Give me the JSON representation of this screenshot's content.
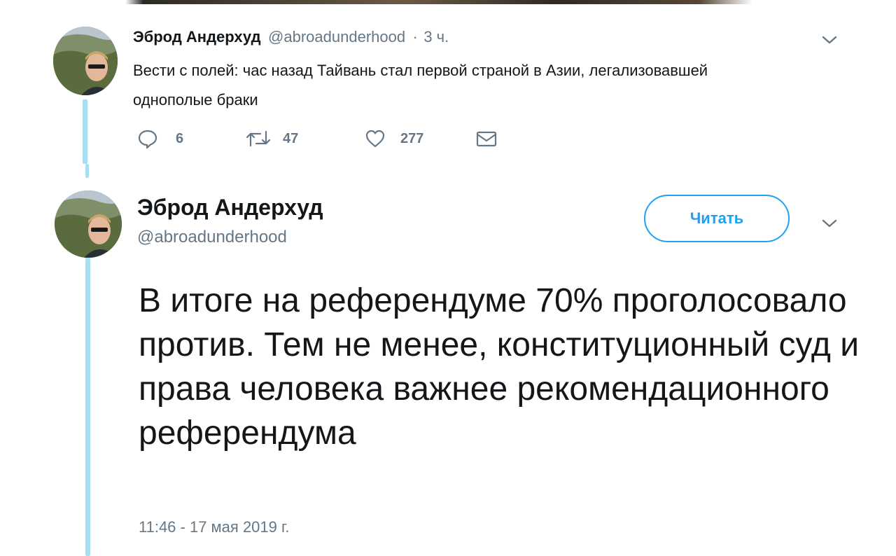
{
  "tweet1": {
    "author_name": "Эброд Андерхуд",
    "handle": "@abroadunderhood",
    "separator": "·",
    "time": "3 ч.",
    "text": "Вести с полей: час назад Тайвань стал первой страной в Азии, легализовавшей однополые браки",
    "actions": {
      "reply_count": "6",
      "retweet_count": "47",
      "like_count": "277"
    }
  },
  "tweet2": {
    "author_name": "Эброд Андерхуд",
    "handle": "@abroadunderhood",
    "follow_label": "Читать",
    "text": "В итоге на референдуме 70% проголосовало против. Тем не менее, конституционный суд и права человека важнее рекомендационного референдума",
    "timestamp": "11:46 - 17 мая 2019 г."
  },
  "colors": {
    "accent": "#1da1f2",
    "thread_line": "#a8dff2",
    "secondary_text": "#657786",
    "primary_text": "#14171a"
  }
}
